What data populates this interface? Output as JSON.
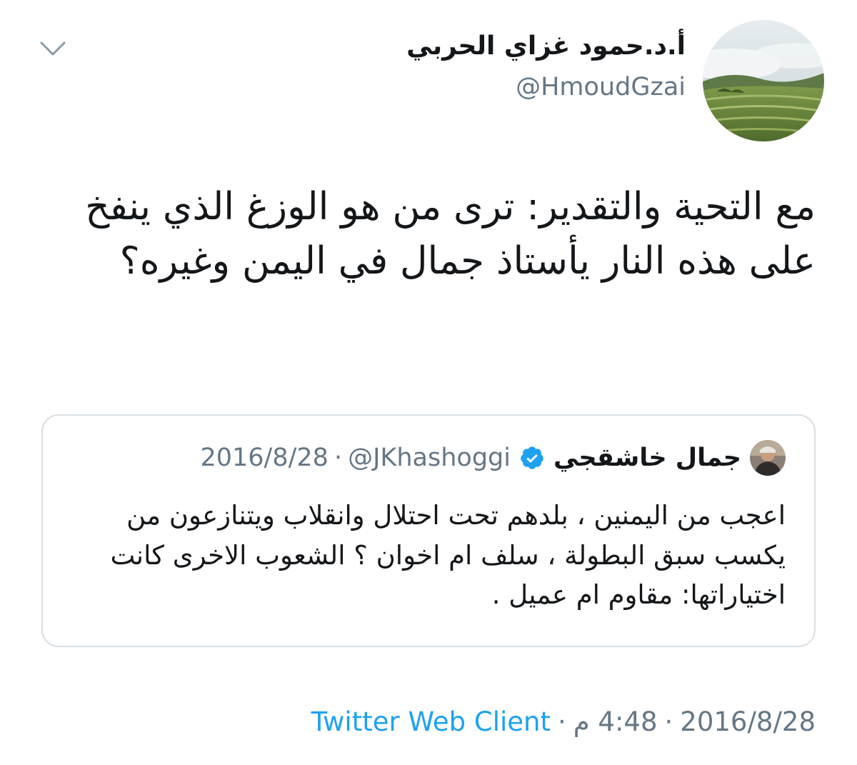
{
  "author": {
    "display_name": "أ.د.حمود غزاي الحربي",
    "handle": "@HmoudGzai"
  },
  "tweet": {
    "text": "مع التحية والتقدير: ترى من هو الوزغ الذي ينفخ  على هذه النار يأستاذ جمال في اليمن وغيره؟"
  },
  "quoted_tweet": {
    "display_name": "جمال خاشقجي",
    "handle": "@JKhashoggi",
    "separator": "·",
    "date": "2016/8/28",
    "text": "اعجب من اليمنين ، بلدهم تحت احتلال وانقلاب ويتنازعون من يكسب سبق البطولة ، سلف ام اخوان ؟ الشعوب الاخرى كانت اختياراتها: مقاوم ام عميل ."
  },
  "footer": {
    "date": "2016/8/28",
    "separator": "·",
    "time": "4:48 م",
    "client": "Twitter Web Client"
  },
  "colors": {
    "secondary_text": "#657786",
    "link": "#1da1f2",
    "verified": "#1da1f2",
    "border": "#d8dfe5"
  },
  "icons": {
    "more": "chevron-down-icon",
    "verified": "verified-badge-icon"
  }
}
